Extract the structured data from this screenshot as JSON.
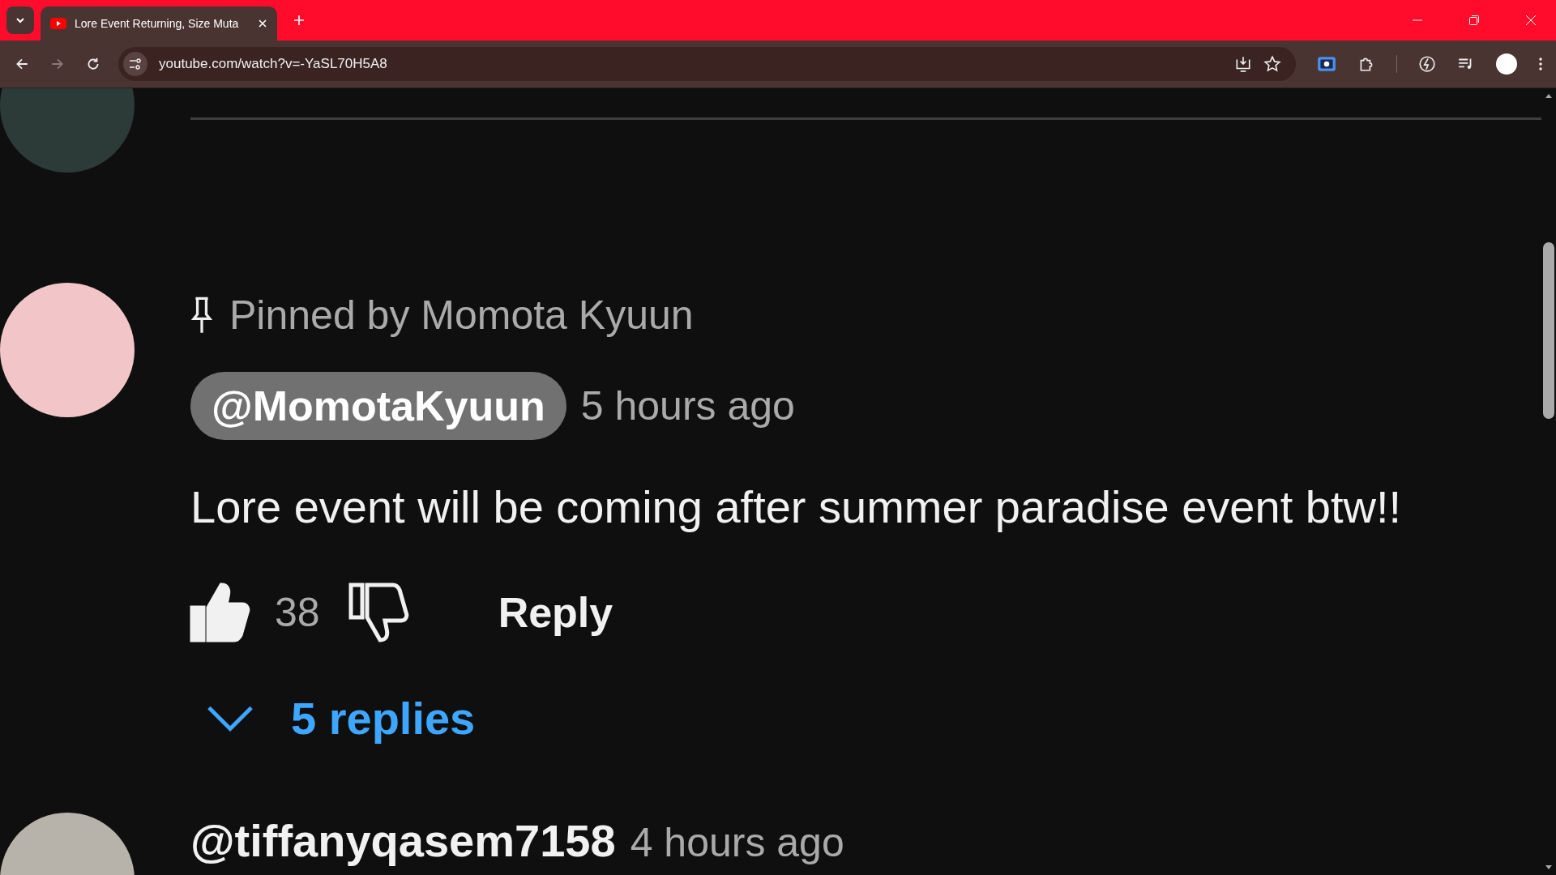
{
  "browser": {
    "tab_title": "Lore Event Returning, Size Muta",
    "url": "youtube.com/watch?v=-YaSL70H5A8"
  },
  "pinned_comment": {
    "pinned_label": "Pinned by Momota Kyuun",
    "author": "@MomotaKyuun",
    "time": "5 hours ago",
    "text": "Lore event will be coming after summer paradise event btw!!",
    "likes": "38",
    "liked": true,
    "reply_label": "Reply",
    "replies_label": "5 replies"
  },
  "next_comment": {
    "author": "@tiffanyqasem7158",
    "time": "4 hours ago"
  }
}
